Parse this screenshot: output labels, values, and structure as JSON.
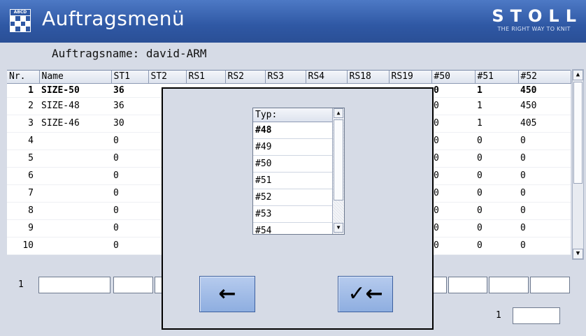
{
  "header": {
    "title": "Auftragsmenü",
    "brand": "STOLL",
    "tagline": "THE RIGHT WAY TO KNIT",
    "icon_label": "ABCD",
    "app_icon": "order-grid-icon"
  },
  "order": {
    "label": "Auftragsname: david-ARM"
  },
  "table": {
    "columns": [
      "Nr.",
      "Name",
      "ST1",
      "ST2",
      "RS1",
      "RS2",
      "RS3",
      "RS4",
      "RS18",
      "RS19",
      "#50",
      "#51",
      "#52"
    ],
    "rows": [
      {
        "nr": "1",
        "name": "SIZE-50",
        "st1": "36",
        "c50": "0",
        "c51": "1",
        "c52": "450",
        "bold": true
      },
      {
        "nr": "2",
        "name": "SIZE-48",
        "st1": "36",
        "c50": "0",
        "c51": "1",
        "c52": "450"
      },
      {
        "nr": "3",
        "name": "SIZE-46",
        "st1": "30",
        "c50": "0",
        "c51": "1",
        "c52": "405"
      },
      {
        "nr": "4",
        "name": "",
        "st1": "0",
        "c50": "0",
        "c51": "0",
        "c52": "0"
      },
      {
        "nr": "5",
        "name": "",
        "st1": "0",
        "c50": "0",
        "c51": "0",
        "c52": "0"
      },
      {
        "nr": "6",
        "name": "",
        "st1": "0",
        "c50": "0",
        "c51": "0",
        "c52": "0"
      },
      {
        "nr": "7",
        "name": "",
        "st1": "0",
        "c50": "0",
        "c51": "0",
        "c52": "0"
      },
      {
        "nr": "8",
        "name": "",
        "st1": "0",
        "c50": "0",
        "c51": "0",
        "c52": "0"
      },
      {
        "nr": "9",
        "name": "",
        "st1": "0",
        "c50": "0",
        "c51": "0",
        "c52": "0"
      },
      {
        "nr": "10",
        "name": "",
        "st1": "0",
        "c50": "0",
        "c51": "0",
        "c52": "0"
      }
    ]
  },
  "scrollbar": {
    "up": "▲",
    "down": "▼"
  },
  "edit_row": {
    "label": "1",
    "values": [
      "",
      "",
      "",
      "",
      "",
      "",
      ""
    ]
  },
  "pager": {
    "label": "1",
    "value": ""
  },
  "dialog": {
    "list_header": "Typ:",
    "options": [
      "#48",
      "#49",
      "#50",
      "#51",
      "#52",
      "#53",
      "#54"
    ],
    "selected": "#48",
    "back_icon": "arrow-left-icon",
    "back_label": "←",
    "confirm_icon": "check-back-icon",
    "confirm_label": "✓←"
  },
  "colors": {
    "title_bar": "#2f58a4",
    "background": "#d6dbe6",
    "button": "#a5bfea"
  }
}
